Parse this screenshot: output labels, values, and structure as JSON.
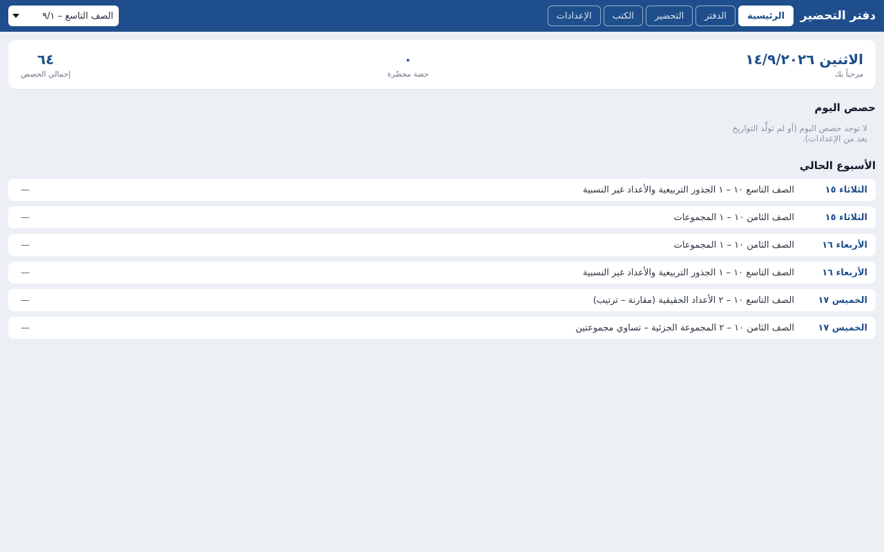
{
  "header": {
    "brand": "دفتر التحضير",
    "nav": [
      {
        "label": "الرئيسية",
        "active": true
      },
      {
        "label": "الدفتر",
        "active": false
      },
      {
        "label": "التحضير",
        "active": false
      },
      {
        "label": "الكتب",
        "active": false
      },
      {
        "label": "الإعدادات",
        "active": false
      }
    ],
    "class_select": {
      "value": "الصف التاسع – ٩/١"
    }
  },
  "summary": {
    "greeting_date": "الاثنين ١٤/٩/٢٠٢٦",
    "greeting_sub": "مرحباً بك",
    "prepared_value": "٠",
    "prepared_label": "حصة محضّرة",
    "total_value": "٦٤",
    "total_label": "إجمالي الحصص"
  },
  "today": {
    "title": "حصص اليوم",
    "empty": "لا توجد حصص اليوم (أو لم تولَّد التواريخ بعد من الإعدادات)."
  },
  "week": {
    "title": "الأسبوع الحالي",
    "rows": [
      {
        "day": "الثلاثاء ١٥",
        "lesson": "الصف التاسع ١٠ – ١ الجذور التربيعية والأعداد غير النسبية",
        "status": "—"
      },
      {
        "day": "الثلاثاء ١٥",
        "lesson": "الصف الثامن ١٠ – ١ المجموعات",
        "status": "—"
      },
      {
        "day": "الأربعاء ١٦",
        "lesson": "الصف الثامن ١٠ – ١ المجموعات",
        "status": "—"
      },
      {
        "day": "الأربعاء ١٦",
        "lesson": "الصف التاسع ١٠ – ١ الجذور التربيعية والأعداد غير النسبية",
        "status": "—"
      },
      {
        "day": "الخميس ١٧",
        "lesson": "الصف التاسع ١٠ – ٢ الأعداد الحقيقية (مقارنة – ترتيب)",
        "status": "—"
      },
      {
        "day": "الخميس ١٧",
        "lesson": "الصف الثامن ١٠ – ٢ المجموعة الجزئية – تساوي مجموعتين",
        "status": "—"
      }
    ]
  },
  "colors": {
    "primary": "#1E4E8C",
    "background": "#ECF0F5",
    "card": "#FFFFFF"
  }
}
